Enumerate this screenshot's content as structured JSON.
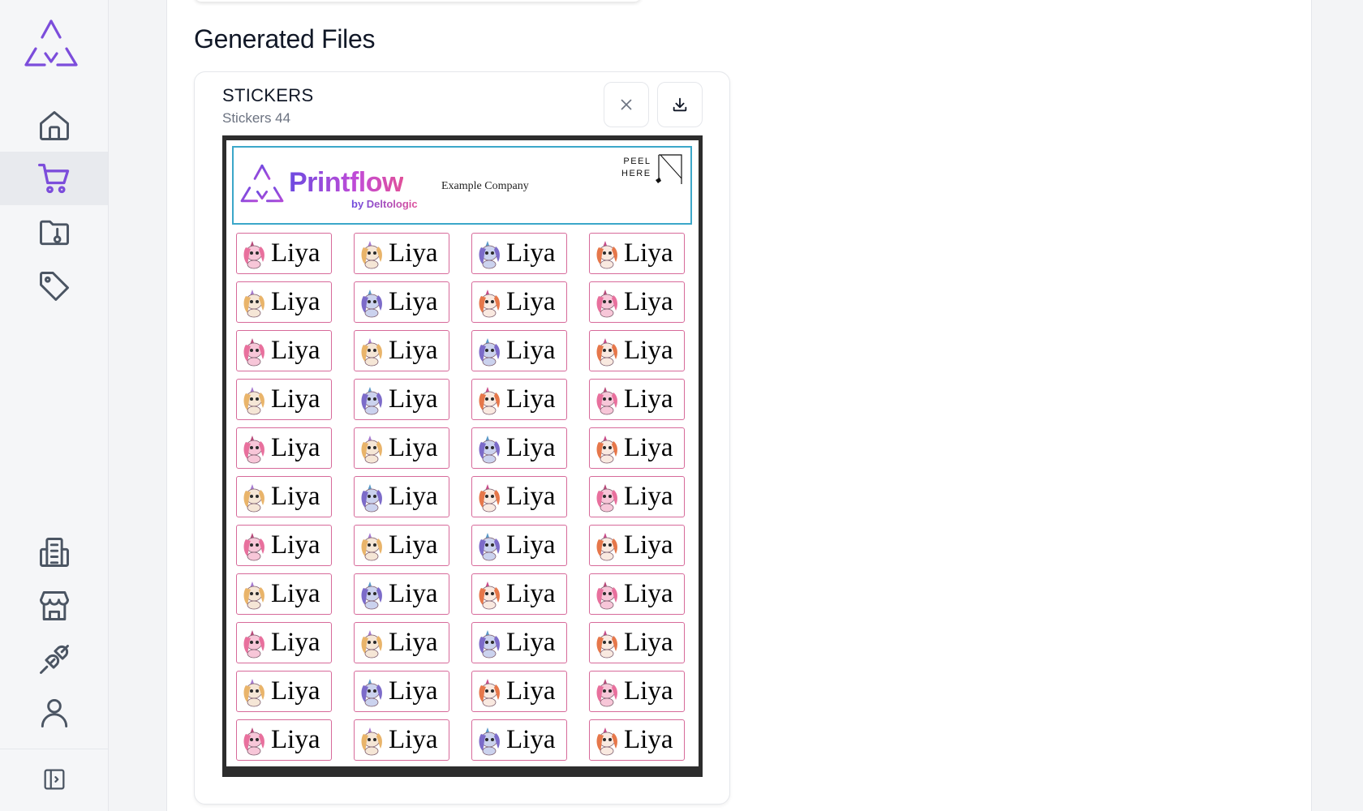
{
  "section": {
    "title": "Generated Files"
  },
  "file": {
    "name": "STICKERS",
    "subtitle": "Stickers 44"
  },
  "sheet": {
    "brand": "Printflow",
    "brand_sub": "by Deltologic",
    "company": "Example Company",
    "peel_line1": "PEEL",
    "peel_line2": "HERE",
    "sticker_name": "Liya",
    "rows": 11,
    "cols": 4
  },
  "sidebar": {
    "items": [
      "home-icon",
      "cart-icon",
      "folder-icon",
      "tag-icon",
      "building-icon",
      "store-icon",
      "plug-icon",
      "user-icon"
    ],
    "active": "cart-icon",
    "toggle": "sidebar-toggle-icon"
  },
  "colors": {
    "accent": "#7c4ddb",
    "icon": "#4b5563",
    "sticker_border": "#d76a9a",
    "header_border": "#3ba7c9"
  }
}
